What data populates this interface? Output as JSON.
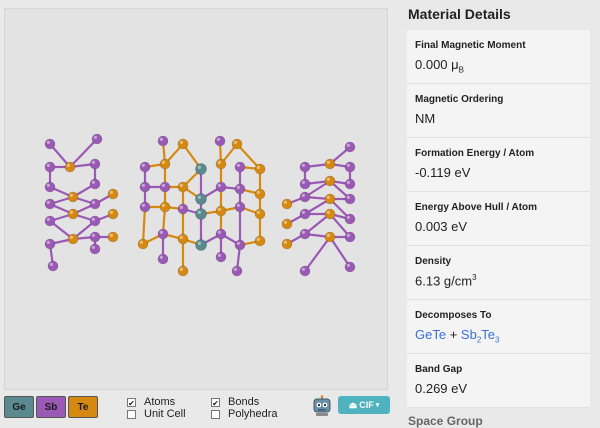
{
  "viewer": {
    "colors": {
      "Ge": "#5a8a8f",
      "Sb": "#9b59b6",
      "Te": "#d68910",
      "bond_sb": "#9b59b6",
      "bond_te": "#d68910"
    }
  },
  "legend": [
    {
      "symbol": "Ge",
      "color": "#5a8a8f"
    },
    {
      "symbol": "Sb",
      "color": "#9b59b6"
    },
    {
      "symbol": "Te",
      "color": "#d68910"
    }
  ],
  "controls": {
    "atoms": {
      "label": "Atoms",
      "checked": true
    },
    "unit_cell": {
      "label": "Unit Cell",
      "checked": false
    },
    "bonds": {
      "label": "Bonds",
      "checked": true
    },
    "polyhedra": {
      "label": "Polyhedra",
      "checked": false
    }
  },
  "robot_icon": "robot-icon",
  "download": {
    "label": "CIF",
    "color": "#4fb3bf"
  },
  "panel": {
    "title": "Material Details",
    "magnetic_moment": {
      "label": "Final Magnetic Moment",
      "value": "0.000",
      "unit": "μ",
      "unit_sub": "B"
    },
    "magnetic_ordering": {
      "label": "Magnetic Ordering",
      "value": "NM"
    },
    "formation_energy": {
      "label": "Formation Energy / Atom",
      "value": "-0.119 eV"
    },
    "energy_above_hull": {
      "label": "Energy Above Hull / Atom",
      "value": "0.003 eV"
    },
    "density": {
      "label": "Density",
      "value": "6.13 g/cm",
      "sup": "3"
    },
    "decomposes": {
      "label": "Decomposes To",
      "first": "GeTe",
      "plus": " + ",
      "second_a": "Sb",
      "second_sub1": "2",
      "second_b": "Te",
      "second_sub2": "3"
    },
    "band_gap": {
      "label": "Band Gap",
      "value": "0.269 eV"
    },
    "cut_text": "Space Group"
  }
}
